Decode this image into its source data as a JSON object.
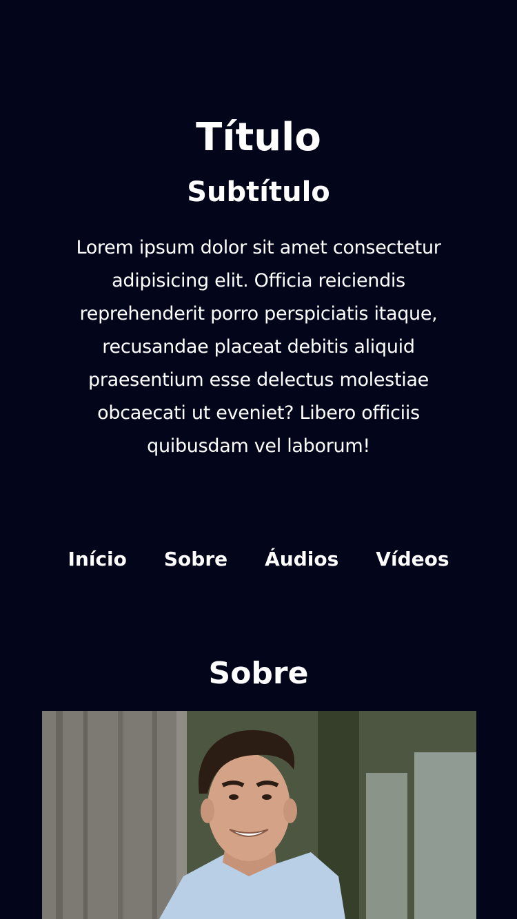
{
  "hero": {
    "title": "Título",
    "subtitle": "Subtítulo",
    "text": "Lorem ipsum dolor sit amet consectetur adipisicing elit. Officia reiciendis reprehenderit porro perspiciatis itaque, recusandae placeat debitis aliquid praesentium esse delectus molestiae obcaecati ut eveniet? Libero officiis quibusdam vel laborum!"
  },
  "nav": {
    "items": [
      {
        "label": "Início"
      },
      {
        "label": "Sobre"
      },
      {
        "label": "Áudios"
      },
      {
        "label": "Vídeos"
      }
    ]
  },
  "about": {
    "title": "Sobre"
  },
  "colors": {
    "background": "#03061a",
    "text": "#ffffff"
  }
}
